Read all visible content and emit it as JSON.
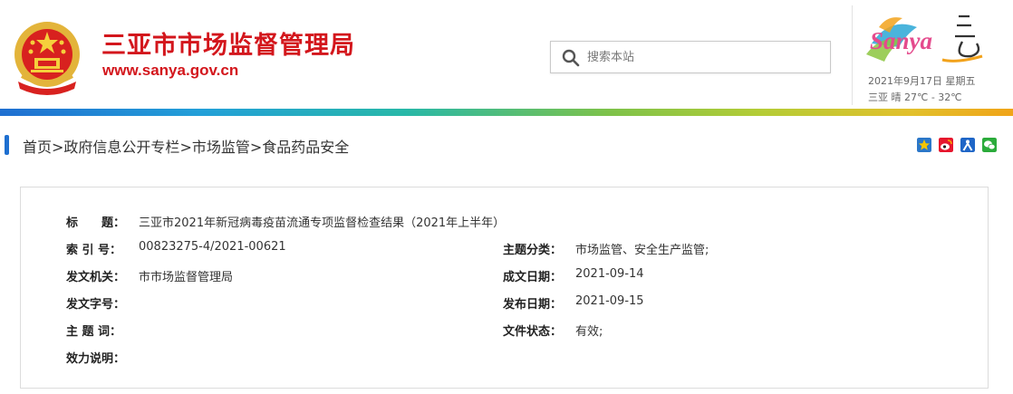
{
  "header": {
    "title": "三亚市市场监督管理局",
    "url": "www.sanya.gov.cn",
    "search": {
      "placeholder": "搜索本站"
    },
    "logo_text": "Sanya",
    "date": "2021年9月17日 星期五",
    "weather": "三亚  晴  27℃ - 32℃"
  },
  "breadcrumb": [
    "首页",
    ">",
    "政府信息公开专栏",
    ">",
    "市场监管",
    ">",
    "食品药品安全"
  ],
  "share_icons": [
    "qzone-icon",
    "weibo-icon",
    "renren-icon",
    "wechat-icon"
  ],
  "colors": {
    "brand_red": "#d3161c",
    "accent_blue": "#1e6fd0"
  },
  "meta": {
    "title_label": "标　　题：",
    "title_value": "三亚市2021年新冠病毒疫苗流通专项监督检查结果（2021年上半年）",
    "index_label": "索 引 号：",
    "index_value": "00823275-4/2021-00621",
    "topic_label": "主题分类：",
    "topic_value": "市场监管、安全生产监管;",
    "org_label": "发文机关：",
    "org_value": "市市场监督管理局",
    "created_label": "成文日期：",
    "created_value": "2021-09-14",
    "docno_label": "发文字号：",
    "docno_value": "",
    "published_label": "发布日期：",
    "published_value": "2021-09-15",
    "keywords_label": "主 题 词：",
    "keywords_value": "",
    "status_label": "文件状态：",
    "status_value": "有效;",
    "effect_label": "效力说明：",
    "effect_value": ""
  }
}
